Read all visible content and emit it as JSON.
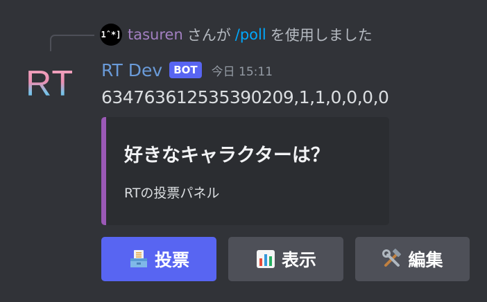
{
  "reply": {
    "avatar_text": "1ˆ*]",
    "username": "tasuren",
    "middle_text": "さんが",
    "command": "/poll",
    "end_text": "を使用しました"
  },
  "message": {
    "avatar_text": "RT",
    "author": "RT Dev",
    "badge": "BOT",
    "timestamp": "今日 15:11",
    "content": "634763612535390209,1,1,0,0,0,0"
  },
  "embed": {
    "accent_color": "#9b59b6",
    "title": "好きなキャラクターは？",
    "description": "RTの投票パネル"
  },
  "buttons": [
    {
      "label": "投票",
      "icon": "ballot-box-icon",
      "style": "primary",
      "color": "#5865f2"
    },
    {
      "label": "表示",
      "icon": "bar-chart-icon",
      "style": "secondary",
      "color": "#4e5058"
    },
    {
      "label": "編集",
      "icon": "hammer-and-wrench-icon",
      "style": "secondary",
      "color": "#4e5058"
    }
  ]
}
